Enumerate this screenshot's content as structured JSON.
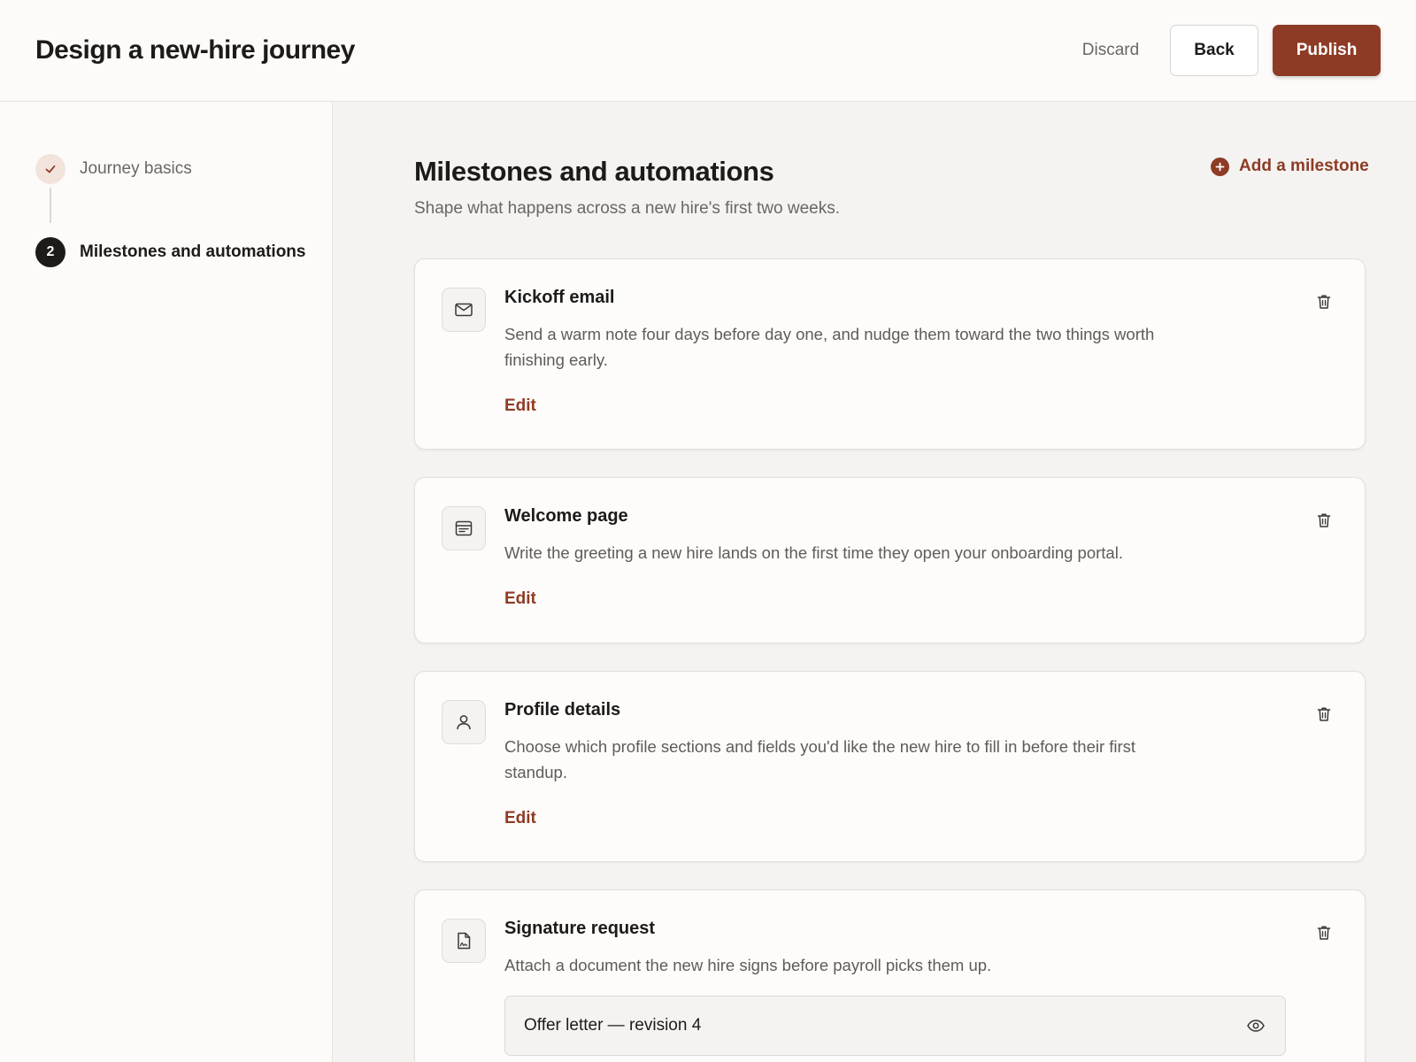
{
  "header": {
    "title": "Design a new-hire journey",
    "discard_label": "Discard",
    "back_label": "Back",
    "publish_label": "Publish"
  },
  "sidebar": {
    "steps": [
      {
        "label": "Journey basics",
        "state": "done",
        "icon": "check-icon"
      },
      {
        "label": "Milestones and automations",
        "state": "current",
        "number": "2"
      }
    ]
  },
  "main": {
    "title": "Milestones and automations",
    "subtitle": "Shape what happens across a new hire's first two weeks.",
    "add_label": "Add a milestone",
    "cards": [
      {
        "title": "Kickoff email",
        "icon": "mail-icon",
        "description": "Send a warm note four days before day one, and nudge them toward the two things worth finishing early.",
        "edit_label": "Edit"
      },
      {
        "title": "Welcome page",
        "icon": "page-icon",
        "description": "Write the greeting a new hire lands on the first time they open your onboarding portal.",
        "edit_label": "Edit"
      },
      {
        "title": "Profile details",
        "icon": "user-icon",
        "description": "Choose which profile sections and fields you'd like the new hire to fill in before their first standup.",
        "edit_label": "Edit"
      },
      {
        "title": "Signature request",
        "icon": "signature-document-icon",
        "description": "Attach a document the new hire signs before payroll picks them up.",
        "document_name": "Offer letter — revision 4"
      }
    ]
  },
  "colors": {
    "accent": "#8e3b25",
    "text_primary": "#1c1b1a",
    "text_secondary": "#6a6663",
    "background": "#f4f3f2",
    "surface": "#fcfbfa"
  }
}
